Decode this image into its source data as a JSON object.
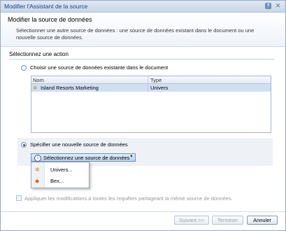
{
  "window": {
    "title": "Modifier l'Assistant de la source"
  },
  "header": {
    "title": "Modifier la source de données",
    "description": "Sélectionner une autre source de données : une source de données existant dans le document ou une nouvelle source de données."
  },
  "section_title": "Sélectionnez une action",
  "option_existing": {
    "label": "Choisir une source de données existante dans le document",
    "selected": false
  },
  "table": {
    "columns": [
      "Nom",
      "Type"
    ],
    "rows": [
      {
        "name": "Island Resorts Marketing",
        "type": "Univers"
      }
    ]
  },
  "option_new": {
    "label": "Spécifier une nouvelle source de données",
    "selected": true
  },
  "dropdown": {
    "label": "Sélectionnez une source de données",
    "items": [
      {
        "label": "Univers...",
        "icon": "universe-icon"
      },
      {
        "label": "Bex...",
        "icon": "bex-icon"
      }
    ]
  },
  "apply_checkbox": {
    "label": "Appliquer les modifications à toutes les requêtes partageant la même source de données.",
    "checked": false
  },
  "buttons": {
    "next": "Suivant >>",
    "finish": "Terminer",
    "cancel": "Annuler"
  },
  "colors": {
    "accent": "#15428b",
    "selection": "#cfe0f5"
  }
}
